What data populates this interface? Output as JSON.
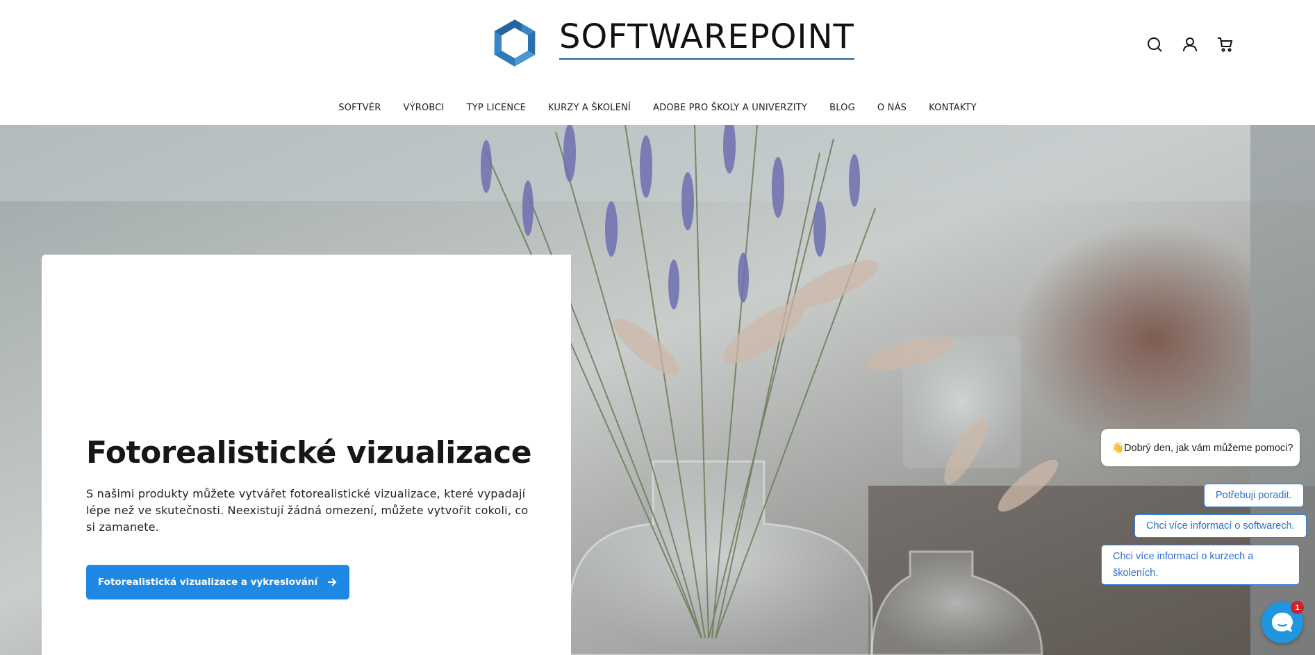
{
  "header": {
    "brand": "SOFTWAREPOINT",
    "icons": [
      "search-icon",
      "user-icon",
      "cart-icon"
    ],
    "nav": [
      "SOFTVÉR",
      "VÝROBCI",
      "TYP LICENCE",
      "KURZY A ŠKOLENÍ",
      "ADOBE PRO ŠKOLY A UNIVERZITY",
      "BLOG",
      "O NÁS",
      "KONTAKTY"
    ]
  },
  "hero": {
    "title": "Fotorealistické vizualizace",
    "text": "S našimi produkty můžete vytvářet fotorealistické vizualizace, které vypadají lépe než ve skutečnosti. Neexistují žádná omezení, můžete vytvořit cokoli, co si zamanete.",
    "cta_label": "Fotorealistická vizualizace a vykreslování"
  },
  "chat": {
    "greeting": "👋Dobrý den, jak vám můžeme pomoci?",
    "options": [
      "Potřebuji poradit.",
      "Chci více informací o softwarech.",
      "Chci více informací o kurzech a školeních."
    ],
    "badge_count": "1"
  },
  "colors": {
    "accent": "#1e88e5",
    "brand_blue": "#3a86c8",
    "chat_blue": "#2196e0",
    "badge_red": "#d0202a"
  }
}
